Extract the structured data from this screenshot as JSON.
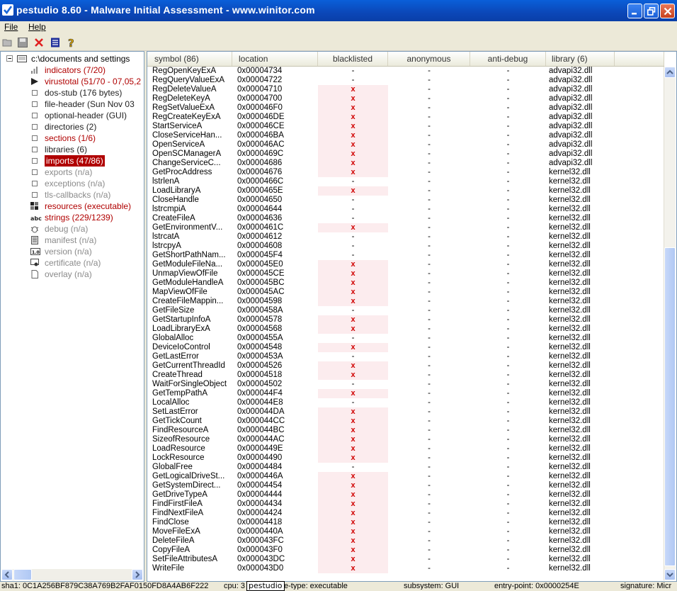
{
  "window": {
    "title": "pestudio 8.60 - Malware Initial Assessment - www.winitor.com"
  },
  "menu": {
    "file": "File",
    "help": "Help"
  },
  "tree": {
    "root": "c:\\documents and settings",
    "items": [
      {
        "label": "indicators (7/20)",
        "style": "red",
        "icon": "bar-chart-icon"
      },
      {
        "label": "virustotal (51/70 - 07,05,2",
        "style": "red",
        "icon": "virustotal-icon"
      },
      {
        "label": "dos-stub (176 bytes)",
        "style": "dark",
        "icon": "box-icon"
      },
      {
        "label": "file-header (Sun Nov 03",
        "style": "dark",
        "icon": "box-icon"
      },
      {
        "label": "optional-header (GUI)",
        "style": "dark",
        "icon": "box-icon"
      },
      {
        "label": "directories (2)",
        "style": "dark",
        "icon": "box-icon"
      },
      {
        "label": "sections (1/6)",
        "style": "red",
        "icon": "box-icon"
      },
      {
        "label": "libraries (6)",
        "style": "dark",
        "icon": "box-icon"
      },
      {
        "label": "imports (47/86)",
        "style": "selected",
        "icon": "box-icon"
      },
      {
        "label": "exports (n/a)",
        "style": "gray",
        "icon": "box-icon"
      },
      {
        "label": "exceptions (n/a)",
        "style": "gray",
        "icon": "box-icon"
      },
      {
        "label": "tls-callbacks (n/a)",
        "style": "gray",
        "icon": "box-icon"
      },
      {
        "label": "resources (executable)",
        "style": "red",
        "icon": "resources-icon"
      },
      {
        "label": "strings (229/1239)",
        "style": "red",
        "icon": "abc-icon"
      },
      {
        "label": "debug (n/a)",
        "style": "gray",
        "icon": "bug-icon"
      },
      {
        "label": "manifest (n/a)",
        "style": "gray",
        "icon": "manifest-icon"
      },
      {
        "label": "version (n/a)",
        "style": "gray",
        "icon": "version-icon"
      },
      {
        "label": "certificate (n/a)",
        "style": "gray",
        "icon": "certificate-icon"
      },
      {
        "label": "overlay (n/a)",
        "style": "gray",
        "icon": "page-icon"
      }
    ]
  },
  "table": {
    "columns": [
      "symbol (86)",
      "location",
      "blacklisted",
      "anonymous",
      "anti-debug",
      "library (6)"
    ],
    "rows": [
      [
        "RegOpenKeyExA",
        "0x00004734",
        "-",
        "-",
        "-",
        "advapi32.dll"
      ],
      [
        "RegQueryValueExA",
        "0x00004722",
        "-",
        "-",
        "-",
        "advapi32.dll"
      ],
      [
        "RegDeleteValueA",
        "0x00004710",
        "x",
        "-",
        "-",
        "advapi32.dll"
      ],
      [
        "RegDeleteKeyA",
        "0x00004700",
        "x",
        "-",
        "-",
        "advapi32.dll"
      ],
      [
        "RegSetValueExA",
        "0x000046F0",
        "x",
        "-",
        "-",
        "advapi32.dll"
      ],
      [
        "RegCreateKeyExA",
        "0x000046DE",
        "x",
        "-",
        "-",
        "advapi32.dll"
      ],
      [
        "StartServiceA",
        "0x000046CE",
        "x",
        "-",
        "-",
        "advapi32.dll"
      ],
      [
        "CloseServiceHan...",
        "0x000046BA",
        "x",
        "-",
        "-",
        "advapi32.dll"
      ],
      [
        "OpenServiceA",
        "0x000046AC",
        "x",
        "-",
        "-",
        "advapi32.dll"
      ],
      [
        "OpenSCManagerA",
        "0x0000469C",
        "x",
        "-",
        "-",
        "advapi32.dll"
      ],
      [
        "ChangeServiceC...",
        "0x00004686",
        "x",
        "-",
        "-",
        "advapi32.dll"
      ],
      [
        "GetProcAddress",
        "0x00004676",
        "x",
        "-",
        "-",
        "kernel32.dll"
      ],
      [
        "lstrlenA",
        "0x0000466C",
        "-",
        "-",
        "-",
        "kernel32.dll"
      ],
      [
        "LoadLibraryA",
        "0x0000465E",
        "x",
        "-",
        "-",
        "kernel32.dll"
      ],
      [
        "CloseHandle",
        "0x00004650",
        "-",
        "-",
        "-",
        "kernel32.dll"
      ],
      [
        "lstrcmpiA",
        "0x00004644",
        "-",
        "-",
        "-",
        "kernel32.dll"
      ],
      [
        "CreateFileA",
        "0x00004636",
        "-",
        "-",
        "-",
        "kernel32.dll"
      ],
      [
        "GetEnvironmentV...",
        "0x0000461C",
        "x",
        "-",
        "-",
        "kernel32.dll"
      ],
      [
        "lstrcatA",
        "0x00004612",
        "-",
        "-",
        "-",
        "kernel32.dll"
      ],
      [
        "lstrcpyA",
        "0x00004608",
        "-",
        "-",
        "-",
        "kernel32.dll"
      ],
      [
        "GetShortPathNam...",
        "0x000045F4",
        "-",
        "-",
        "-",
        "kernel32.dll"
      ],
      [
        "GetModuleFileNa...",
        "0x000045E0",
        "x",
        "-",
        "-",
        "kernel32.dll"
      ],
      [
        "UnmapViewOfFile",
        "0x000045CE",
        "x",
        "-",
        "-",
        "kernel32.dll"
      ],
      [
        "GetModuleHandleA",
        "0x000045BC",
        "x",
        "-",
        "-",
        "kernel32.dll"
      ],
      [
        "MapViewOfFile",
        "0x000045AC",
        "x",
        "-",
        "-",
        "kernel32.dll"
      ],
      [
        "CreateFileMappin...",
        "0x00004598",
        "x",
        "-",
        "-",
        "kernel32.dll"
      ],
      [
        "GetFileSize",
        "0x0000458A",
        "-",
        "-",
        "-",
        "kernel32.dll"
      ],
      [
        "GetStartupInfoA",
        "0x00004578",
        "x",
        "-",
        "-",
        "kernel32.dll"
      ],
      [
        "LoadLibraryExA",
        "0x00004568",
        "x",
        "-",
        "-",
        "kernel32.dll"
      ],
      [
        "GlobalAlloc",
        "0x0000455A",
        "-",
        "-",
        "-",
        "kernel32.dll"
      ],
      [
        "DeviceIoControl",
        "0x00004548",
        "x",
        "-",
        "-",
        "kernel32.dll"
      ],
      [
        "GetLastError",
        "0x0000453A",
        "-",
        "-",
        "-",
        "kernel32.dll"
      ],
      [
        "GetCurrentThreadId",
        "0x00004526",
        "x",
        "-",
        "-",
        "kernel32.dll"
      ],
      [
        "CreateThread",
        "0x00004518",
        "x",
        "-",
        "-",
        "kernel32.dll"
      ],
      [
        "WaitForSingleObject",
        "0x00004502",
        "-",
        "-",
        "-",
        "kernel32.dll"
      ],
      [
        "GetTempPathA",
        "0x000044F4",
        "x",
        "-",
        "-",
        "kernel32.dll"
      ],
      [
        "LocalAlloc",
        "0x000044E8",
        "-",
        "-",
        "-",
        "kernel32.dll"
      ],
      [
        "SetLastError",
        "0x000044DA",
        "x",
        "-",
        "-",
        "kernel32.dll"
      ],
      [
        "GetTickCount",
        "0x000044CC",
        "x",
        "-",
        "-",
        "kernel32.dll"
      ],
      [
        "FindResourceA",
        "0x000044BC",
        "x",
        "-",
        "-",
        "kernel32.dll"
      ],
      [
        "SizeofResource",
        "0x000044AC",
        "x",
        "-",
        "-",
        "kernel32.dll"
      ],
      [
        "LoadResource",
        "0x0000449E",
        "x",
        "-",
        "-",
        "kernel32.dll"
      ],
      [
        "LockResource",
        "0x00004490",
        "x",
        "-",
        "-",
        "kernel32.dll"
      ],
      [
        "GlobalFree",
        "0x00004484",
        "-",
        "-",
        "-",
        "kernel32.dll"
      ],
      [
        "GetLogicalDriveSt...",
        "0x0000446A",
        "x",
        "-",
        "-",
        "kernel32.dll"
      ],
      [
        "GetSystemDirect...",
        "0x00004454",
        "x",
        "-",
        "-",
        "kernel32.dll"
      ],
      [
        "GetDriveTypeA",
        "0x00004444",
        "x",
        "-",
        "-",
        "kernel32.dll"
      ],
      [
        "FindFirstFileA",
        "0x00004434",
        "x",
        "-",
        "-",
        "kernel32.dll"
      ],
      [
        "FindNextFileA",
        "0x00004424",
        "x",
        "-",
        "-",
        "kernel32.dll"
      ],
      [
        "FindClose",
        "0x00004418",
        "x",
        "-",
        "-",
        "kernel32.dll"
      ],
      [
        "MoveFileExA",
        "0x0000440A",
        "x",
        "-",
        "-",
        "kernel32.dll"
      ],
      [
        "DeleteFileA",
        "0x000043FC",
        "x",
        "-",
        "-",
        "kernel32.dll"
      ],
      [
        "CopyFileA",
        "0x000043F0",
        "x",
        "-",
        "-",
        "kernel32.dll"
      ],
      [
        "SetFileAttributesA",
        "0x000043DC",
        "x",
        "-",
        "-",
        "kernel32.dll"
      ],
      [
        "WriteFile",
        "0x000043D0",
        "x",
        "-",
        "-",
        "kernel32.dll"
      ]
    ]
  },
  "status": {
    "sha1": "sha1: 0C1A256BF879C38A769B2FAF0150FD8A4AB6F222",
    "cpu": "cpu: 3",
    "tooltip": "pestudio",
    "type": "e-type: executable",
    "subsystem": "subsystem: GUI",
    "entry": "entry-point: 0x0000254E",
    "signature": "signature: Micr"
  },
  "colors": {
    "accent": "#0a5fd9",
    "danger": "#b00000",
    "blacklist_bg": "#fcecee"
  }
}
